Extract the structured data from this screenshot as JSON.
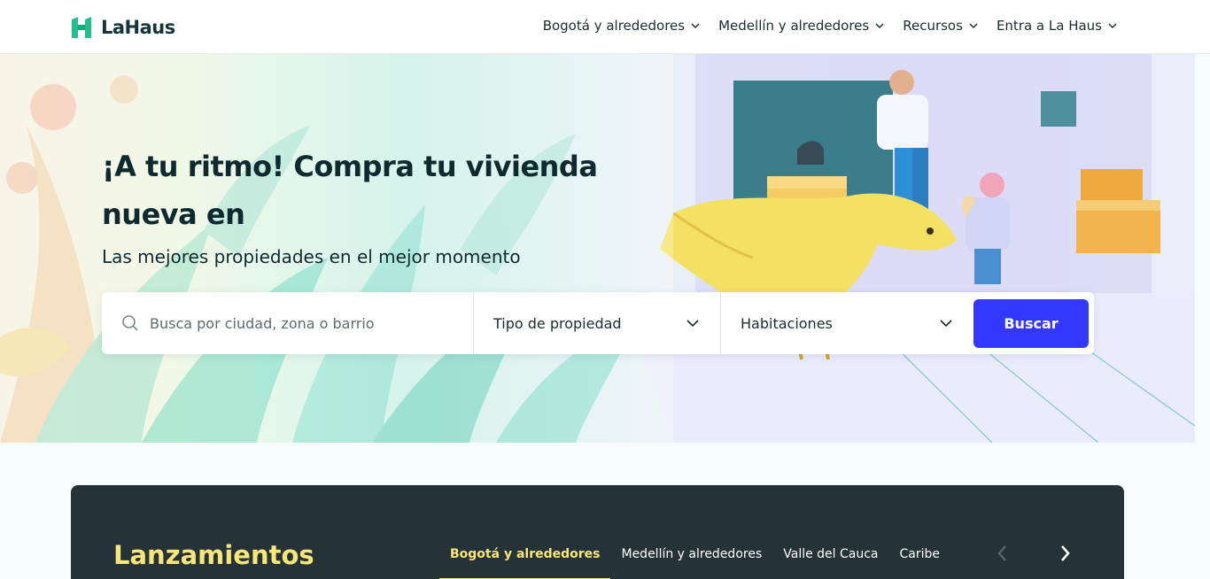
{
  "brand": {
    "name": "LaHaus",
    "accent": "#21c18b"
  },
  "nav": {
    "items": [
      {
        "label": "Bogotá y alrededores"
      },
      {
        "label": "Medellín y alrededores"
      },
      {
        "label": "Recursos"
      },
      {
        "label": "Entra a La Haus"
      }
    ]
  },
  "hero": {
    "title": "¡A tu ritmo! Compra tu vivienda nueva en",
    "subtitle": "Las mejores propiedades en el mejor momento"
  },
  "search": {
    "placeholder": "Busca por ciudad, zona o barrio",
    "type_label": "Tipo de propiedad",
    "rooms_label": "Habitaciones",
    "button_label": "Buscar",
    "button_color": "#3338ff"
  },
  "launches": {
    "title": "Lanzamientos",
    "tabs": [
      {
        "label": "Bogotá y alrededores",
        "active": true
      },
      {
        "label": "Medellín y alrededores",
        "active": false
      },
      {
        "label": "Valle del Cauca",
        "active": false
      },
      {
        "label": "Caribe",
        "active": false
      }
    ],
    "accent": "#f7e67a"
  }
}
